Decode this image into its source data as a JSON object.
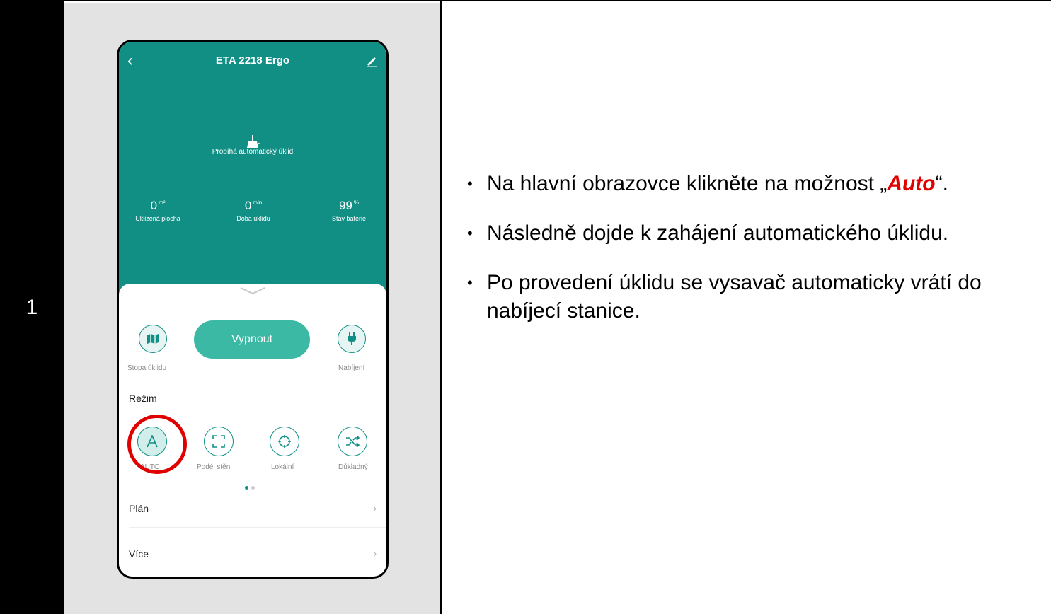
{
  "step": {
    "number": "1"
  },
  "phone": {
    "title": "ETA 2218 Ergo",
    "status": "Probíhá automatický úklid",
    "stats": [
      {
        "value": "0",
        "unit": "m²",
        "label": "Uklizená plocha"
      },
      {
        "value": "0",
        "unit": "min",
        "label": "Doba úklidu"
      },
      {
        "value": "99",
        "unit": "%",
        "label": "Stav baterie"
      }
    ],
    "buttons": {
      "track_label": "Stopa úklidu",
      "main_label": "Vypnout",
      "charge_label": "Nabíjení"
    },
    "mode": {
      "heading": "Režim",
      "items": [
        {
          "label": "AUTO",
          "icon": "auto-icon"
        },
        {
          "label": "Podél stěn",
          "icon": "wall-icon"
        },
        {
          "label": "Lokální",
          "icon": "spot-icon"
        },
        {
          "label": "Důkladný",
          "icon": "random-icon"
        }
      ]
    },
    "rows": [
      {
        "label": "Plán"
      },
      {
        "label": "Více"
      }
    ]
  },
  "instructions": {
    "b1_text": "Na hlavní obrazovce klikněte na možnost ",
    "b1_open": "„",
    "b1_highlight": "Auto",
    "b1_close": "“.",
    "b2": "Následně dojde k zahájení automatického úklidu.",
    "b3": "Po provedení úklidu se vysavač automaticky vrátí do nabíjecí stanice.",
    "bullet": "•"
  },
  "colors": {
    "teal": "#118f85",
    "button": "#3bb9a5",
    "highlight": "#e00000"
  }
}
